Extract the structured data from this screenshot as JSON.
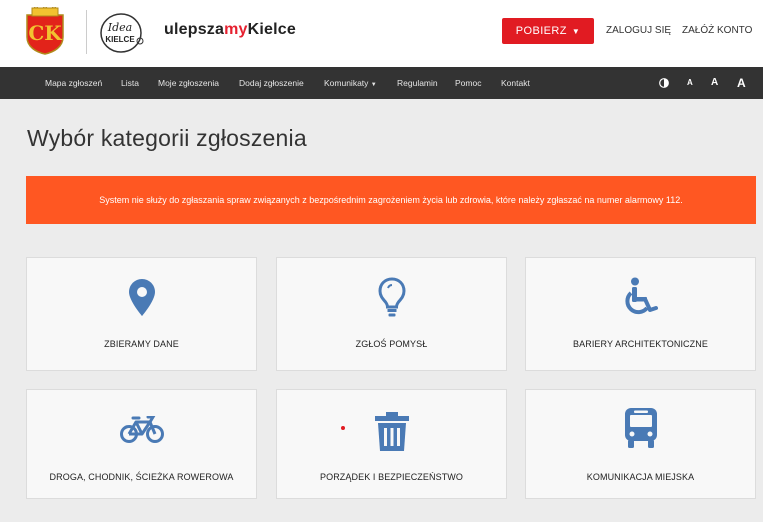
{
  "header": {
    "brand_prefix": "ulepsza",
    "brand_accent": "my",
    "brand_suffix": "Kielce",
    "download_label": "POBIERZ",
    "login_label": "ZALOGUJ SIĘ",
    "register_label": "ZAŁÓŻ KONTO",
    "crest_text": "CK",
    "idea_logo_top": "Idea",
    "idea_logo_bottom": "KIELCE"
  },
  "nav": {
    "items": [
      "Mapa zgłoszeń",
      "Lista",
      "Moje zgłoszenia",
      "Dodaj zgłoszenie",
      "Komunikaty",
      "Regulamin",
      "Pomoc",
      "Kontakt"
    ],
    "font_small": "A",
    "font_medium": "A",
    "font_large": "A"
  },
  "main": {
    "title": "Wybór kategorii zgłoszenia",
    "alert": "System nie służy do zgłaszania spraw związanych z bezpośrednim zagrożeniem życia lub zdrowia, które należy zgłaszać na numer alarmowy 112."
  },
  "categories": [
    {
      "label": "ZBIERAMY DANE",
      "icon": "map-marker-icon"
    },
    {
      "label": "ZGŁOŚ POMYSŁ",
      "icon": "lightbulb-icon"
    },
    {
      "label": "BARIERY ARCHITEKTONICZNE",
      "icon": "wheelchair-icon"
    },
    {
      "label": "DROGA, CHODNIK, ŚCIEŻKA ROWEROWA",
      "icon": "bicycle-icon"
    },
    {
      "label": "PORZĄDEK I BEZPIECZEŃSTWO",
      "icon": "trash-icon"
    },
    {
      "label": "KOMUNIKACJA MIEJSKA",
      "icon": "bus-icon"
    }
  ],
  "colors": {
    "accent": "#e11b22",
    "alert": "#ff5722",
    "icon": "#4a7ab5",
    "nav_bg": "#333333"
  }
}
